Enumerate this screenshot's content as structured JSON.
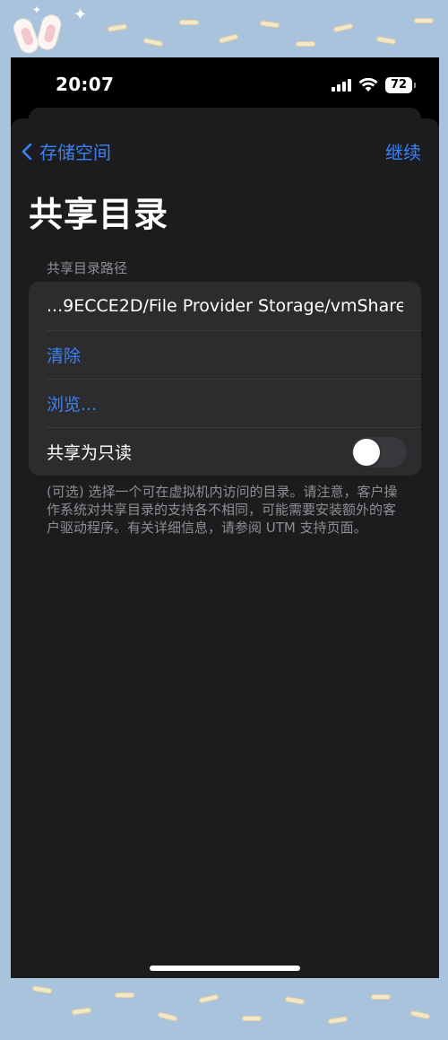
{
  "status_bar": {
    "time": "20:07",
    "battery": "72",
    "icons": [
      "cellular-signal-icon",
      "wifi-icon",
      "battery-icon"
    ]
  },
  "nav": {
    "back_label": "存储空间",
    "continue_label": "继续"
  },
  "page": {
    "title": "共享目录"
  },
  "section": {
    "header": "共享目录路径",
    "path_value": "...9ECCE2D/File Provider Storage/vmShare",
    "clear_label": "清除",
    "browse_label": "浏览...",
    "readonly_label": "共享为只读",
    "readonly_enabled": false,
    "footer": "(可选) 选择一个可在虚拟机内访问的目录。请注意，客户操作系统对共享目录的支持各不相同，可能需要安装额外的客户驱动程序。有关详细信息，请参阅 UTM 支持页面。"
  },
  "colors": {
    "accent": "#3a82f7",
    "sheet_background": "#1c1c1e",
    "group_background": "#2c2c2e",
    "secondary_text": "#8e8e93"
  }
}
